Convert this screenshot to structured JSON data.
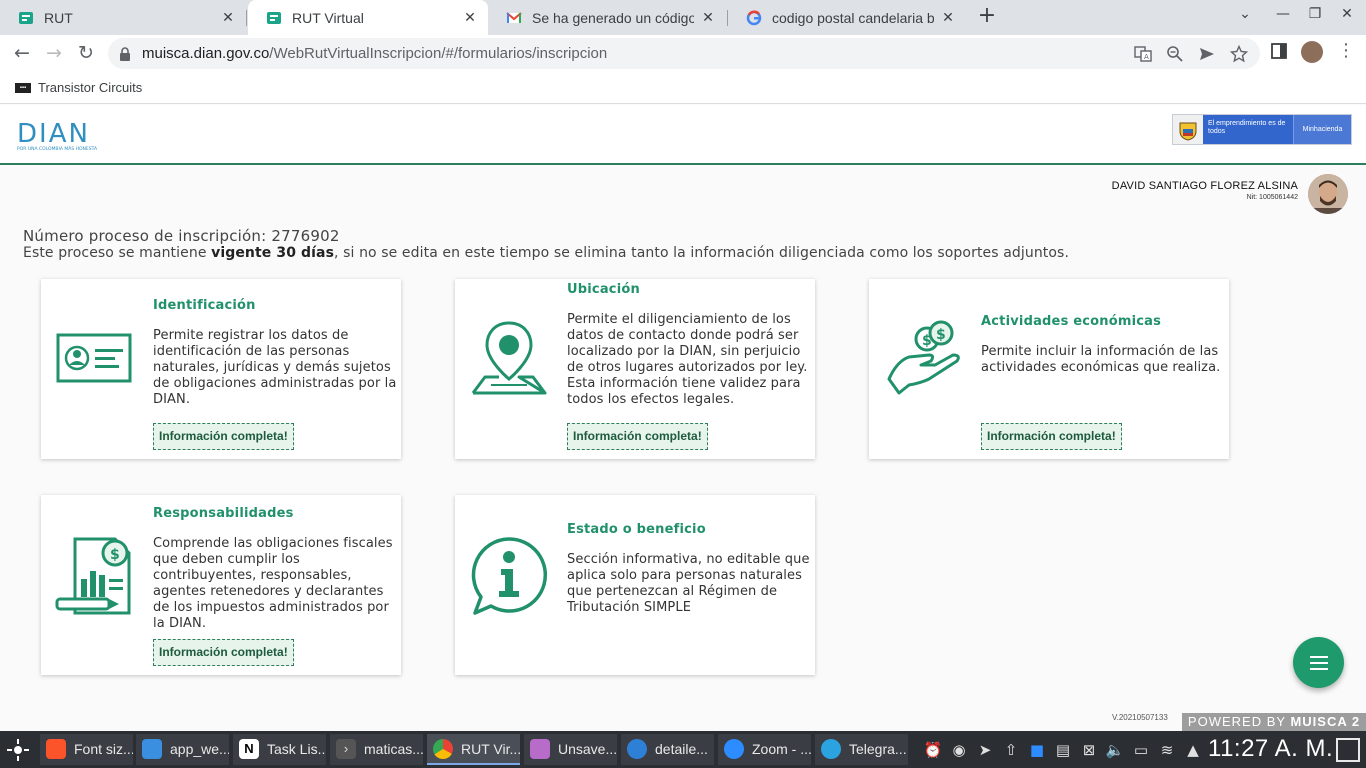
{
  "browser": {
    "tabs": [
      {
        "title": "RUT",
        "icon": "rut-icon",
        "active": false
      },
      {
        "title": "RUT Virtual",
        "icon": "rut-icon",
        "active": true
      },
      {
        "title": "Se ha generado un código ele",
        "icon": "gmail-icon",
        "active": false
      },
      {
        "title": "codigo postal candelaria bog",
        "icon": "google-icon",
        "active": false
      }
    ],
    "url_domain": "muisca.dian.gov.co",
    "url_path": "/WebRutVirtualInscripcion/#/formularios/inscripcion",
    "bookmark": "Transistor Circuits"
  },
  "header": {
    "logo_text": "DIAN",
    "logo_tagline": "POR UNA COLOMBIA MÁS HONESTA",
    "gov_text": "El emprendimiento es de todos",
    "gov_ministry": "Minhacienda"
  },
  "user": {
    "name": "DAVID SANTIAGO FLOREZ ALSINA",
    "nit": "Nit: 1005061442"
  },
  "process": {
    "label": "Número proceso de inscripción: 2776902",
    "note_prefix": "Este proceso se mantiene ",
    "note_bold": "vigente 30 días",
    "note_suffix": ", si no se edita en este tiempo se elimina tanto la información diligenciada como los soportes adjuntos."
  },
  "cards": {
    "identificacion": {
      "title": "Identificación",
      "desc": "Permite registrar los datos de identificación de las personas naturales, jurídicas y demás sujetos de obligaciones administradas por la DIAN.",
      "badge": "Información completa!"
    },
    "ubicacion": {
      "title": "Ubicación",
      "desc": "Permite el diligenciamiento de los datos de contacto donde podrá ser localizado por la DIAN, sin perjuicio de otros lugares autorizados por ley. Esta información tiene validez para todos los efectos legales.",
      "badge": "Información completa!"
    },
    "actividades": {
      "title": "Actividades económicas",
      "desc": "Permite incluir la información de las actividades económicas que realiza.",
      "badge": "Información completa!"
    },
    "responsabilidades": {
      "title": "Responsabilidades",
      "desc": "Comprende las obligaciones fiscales que deben cumplir los contribuyentes, responsables, agentes retenedores y declarantes de los impuestos administrados por la DIAN.",
      "badge": "Información completa!"
    },
    "estado": {
      "title": "Estado o beneficio",
      "desc": "Sección informativa, no editable que aplica solo para personas naturales que pertenezcan al Régimen de Tributación SIMPLE"
    }
  },
  "footer": {
    "version": "V.20210507133",
    "powered_prefix": "POWERED BY ",
    "powered_brand": "MUISCA 2"
  },
  "taskbar": {
    "items": [
      {
        "label": "Font siz...",
        "icon": "brave-icon"
      },
      {
        "label": "app_we...",
        "icon": "folder-icon"
      },
      {
        "label": "Task Lis...",
        "icon": "notion-icon"
      },
      {
        "label": "maticas...",
        "icon": "terminal-icon"
      },
      {
        "label": "RUT Vir...",
        "icon": "chrome-icon"
      },
      {
        "label": "Unsave...",
        "icon": "editor-icon"
      },
      {
        "label": "detaile...",
        "icon": "browser-icon"
      },
      {
        "label": "Zoom - ...",
        "icon": "zoom-icon"
      },
      {
        "label": "Telegra...",
        "icon": "telegram-icon"
      }
    ],
    "clock": "11:27 A. M."
  },
  "colors": {
    "accent": "#21916b",
    "badge_bg": "#e6f4ec",
    "fab": "#1f9a6d"
  }
}
